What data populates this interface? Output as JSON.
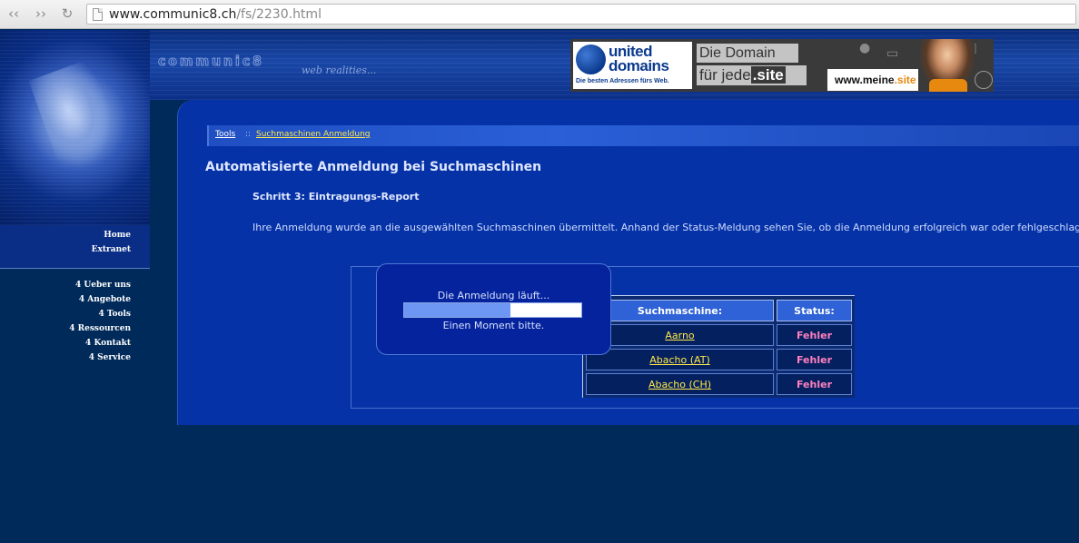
{
  "browser": {
    "url_host": "www.communic8.ch",
    "url_path": "/fs/2230.html",
    "back_icon": "back-arrow-icon",
    "forward_icon": "forward-arrow-icon",
    "reload_icon": "reload-icon"
  },
  "header": {
    "logo_text": "communic8",
    "tagline": "web realities..."
  },
  "banner": {
    "brand_line1": "united",
    "brand_line2": "domains",
    "brand_tagline": "Die besten Adressen fürs Web.",
    "headline1": "Die Domain",
    "headline2_pre": "für jede",
    "headline2_site": ".site",
    "url_pre": "www.meine",
    "url_site": ".site"
  },
  "sidebar": {
    "top_links": [
      {
        "label": "Home"
      },
      {
        "label": "Extranet"
      }
    ],
    "menu": [
      {
        "label": "4 Ueber uns"
      },
      {
        "label": "4 Angebote"
      },
      {
        "label": "4 Tools"
      },
      {
        "label": "4 Ressourcen"
      },
      {
        "label": "4 Kontakt"
      },
      {
        "label": "4 Service"
      }
    ]
  },
  "breadcrumb": {
    "tools": "Tools",
    "separator": "::",
    "current": "Suchmaschinen Anmeldung"
  },
  "main": {
    "title": "Automatisierte Anmeldung bei Suchmaschinen",
    "step": "Schritt 3: Eintragungs-Report",
    "description": "Ihre Anmeldung wurde an die ausgewählten Suchmaschinen übermittelt. Anhand der Status-Meldung sehen Sie, ob die Anmeldung erfolgreich war oder fehlgeschlagen ist."
  },
  "results": {
    "col_engine": "Suchmaschine:",
    "col_status": "Status:",
    "rows": [
      {
        "engine": "Aarno",
        "status": "Fehler"
      },
      {
        "engine": "Abacho (AT)",
        "status": "Fehler"
      },
      {
        "engine": "Abacho (CH)",
        "status": "Fehler"
      }
    ]
  },
  "progress_dialog": {
    "message": "Die Anmeldung läuft...",
    "wait": "Einen Moment bitte.",
    "progress_fraction": 0.6
  },
  "colors": {
    "page_bg": "#002a5a",
    "panel_bg": "#0532a6",
    "link_yellow": "#ffe84a",
    "error_pink": "#ff7fbf"
  }
}
